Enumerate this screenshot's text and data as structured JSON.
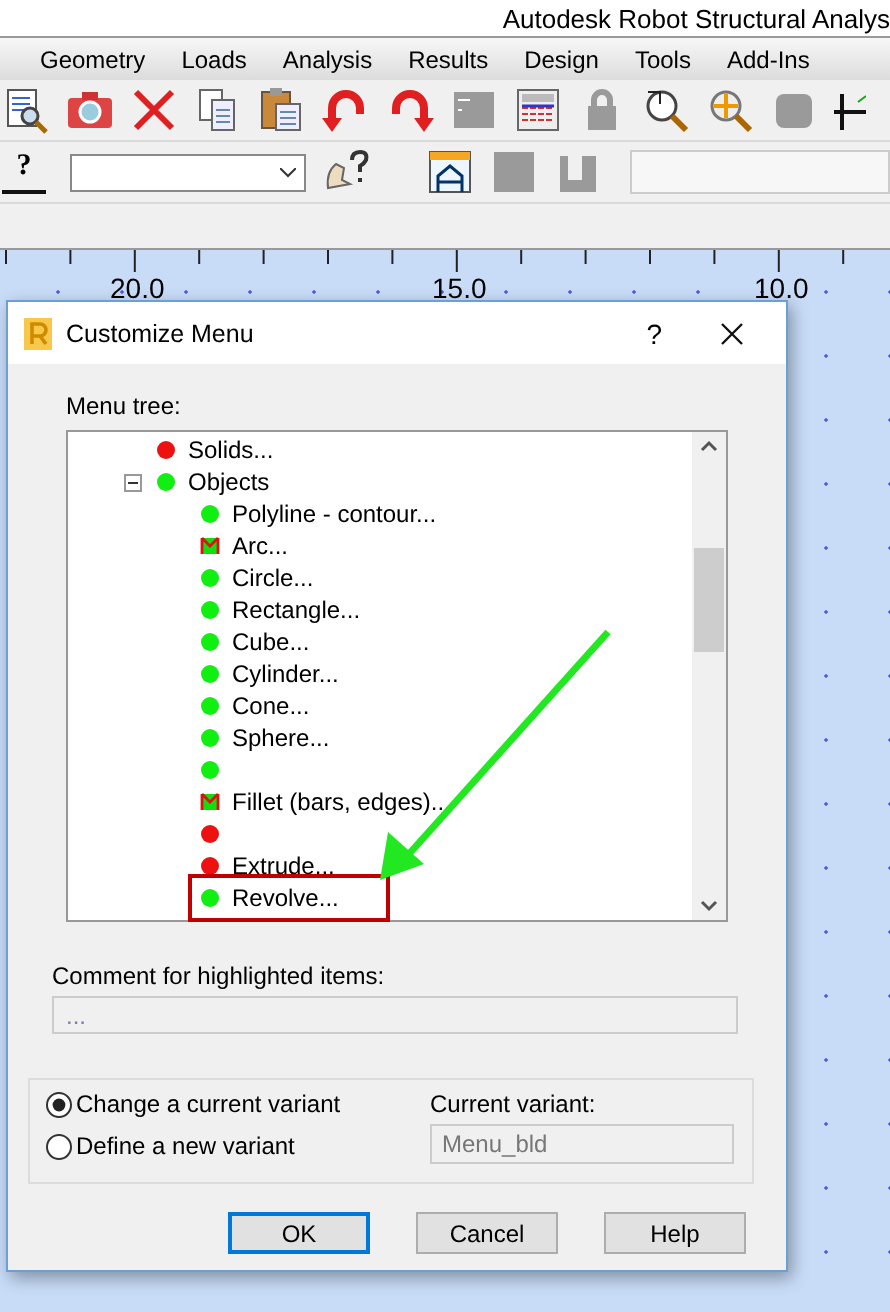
{
  "window": {
    "title": "Autodesk Robot Structural Analys"
  },
  "menu": [
    "Geometry",
    "Loads",
    "Analysis",
    "Results",
    "Design",
    "Tools",
    "Add-Ins"
  ],
  "context_help_glyph": "?",
  "ruler_labels": [
    "20.0",
    "15.0",
    "10.0"
  ],
  "dialog": {
    "title": "Customize Menu",
    "help_button": "?",
    "tree_label": "Menu tree:",
    "tree": [
      {
        "label": "Solids...",
        "kind": "dot",
        "color": "#ee1111"
      },
      {
        "label": "Objects",
        "kind": "dot",
        "color": "#11ee11",
        "expanded": true,
        "children": [
          {
            "label": "Polyline - contour...",
            "kind": "dot",
            "color": "#11ee11",
            "highlighted": false
          },
          {
            "label": "Arc...",
            "kind": "partial",
            "highlighted": false
          },
          {
            "label": "Circle...",
            "kind": "dot",
            "color": "#11ee11",
            "highlighted": false
          },
          {
            "label": "Rectangle...",
            "kind": "dot",
            "color": "#11ee11",
            "highlighted": false
          },
          {
            "label": "Cube...",
            "kind": "dot",
            "color": "#11ee11",
            "highlighted": false
          },
          {
            "label": "Cylinder...",
            "kind": "dot",
            "color": "#11ee11",
            "highlighted": false
          },
          {
            "label": "Cone...",
            "kind": "dot",
            "color": "#11ee11",
            "highlighted": false
          },
          {
            "label": "Sphere...",
            "kind": "dot",
            "color": "#11ee11",
            "highlighted": false
          },
          {
            "kind": "dot",
            "color": "#11ee11",
            "highlighted": false
          },
          {
            "label": "Fillet (bars, edges)...",
            "kind": "partial",
            "highlighted": false
          },
          {
            "kind": "dot",
            "color": "#ee1111",
            "highlighted": false
          },
          {
            "label": "Extrude...",
            "kind": "dot",
            "color": "#ee1111",
            "highlighted": false
          },
          {
            "label": "Revolve...",
            "kind": "dot",
            "color": "#11ee11",
            "highlighted": true
          }
        ]
      }
    ],
    "comment_label": "Comment for highlighted items:",
    "comment_field": {
      "value": "..."
    },
    "variant_options": [
      {
        "label": "Change a current variant",
        "selected": true
      },
      {
        "label": "Define a new variant",
        "selected": false
      }
    ],
    "current_variant_label": "Current variant:",
    "current_variant": {
      "value": "Menu_bld",
      "disabled": true
    },
    "buttons": [
      {
        "label": "OK",
        "focused": true
      },
      {
        "label": "Cancel",
        "focused": false
      },
      {
        "label": "Help",
        "focused": false
      }
    ]
  }
}
